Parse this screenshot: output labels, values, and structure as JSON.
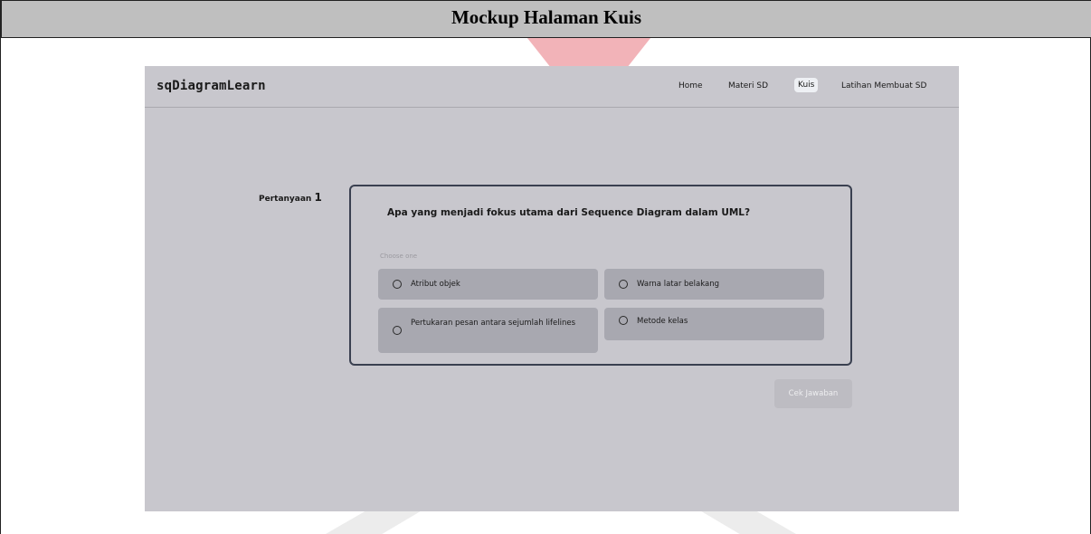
{
  "caption": {
    "title": "Mockup Halaman Kuis"
  },
  "app": {
    "brand": "sqDiagramLearn",
    "nav": [
      {
        "label": "Home",
        "active": false
      },
      {
        "label": "Materi SD",
        "active": false
      },
      {
        "label": "Kuis",
        "active": true
      },
      {
        "label": "Latihan Membuat SD",
        "active": false
      }
    ]
  },
  "quiz": {
    "question_label": "Pertanyaan",
    "question_number": "1",
    "question_text": "Apa yang menjadi fokus utama dari Sequence Diagram dalam UML?",
    "choose_hint": "Choose one",
    "options": [
      {
        "label": "Atribut objek"
      },
      {
        "label": "Warna latar belakang"
      },
      {
        "label": "Pertukaran pesan antara sejumlah lifelines"
      },
      {
        "label": "Metode kelas"
      }
    ],
    "submit_label": "Cek Jawaban"
  },
  "colors": {
    "mockup_background": "#c8c7cd",
    "option_background": "#a8a8b0",
    "card_border": "#3a4050",
    "caption_bar": "#bfbfbf"
  }
}
